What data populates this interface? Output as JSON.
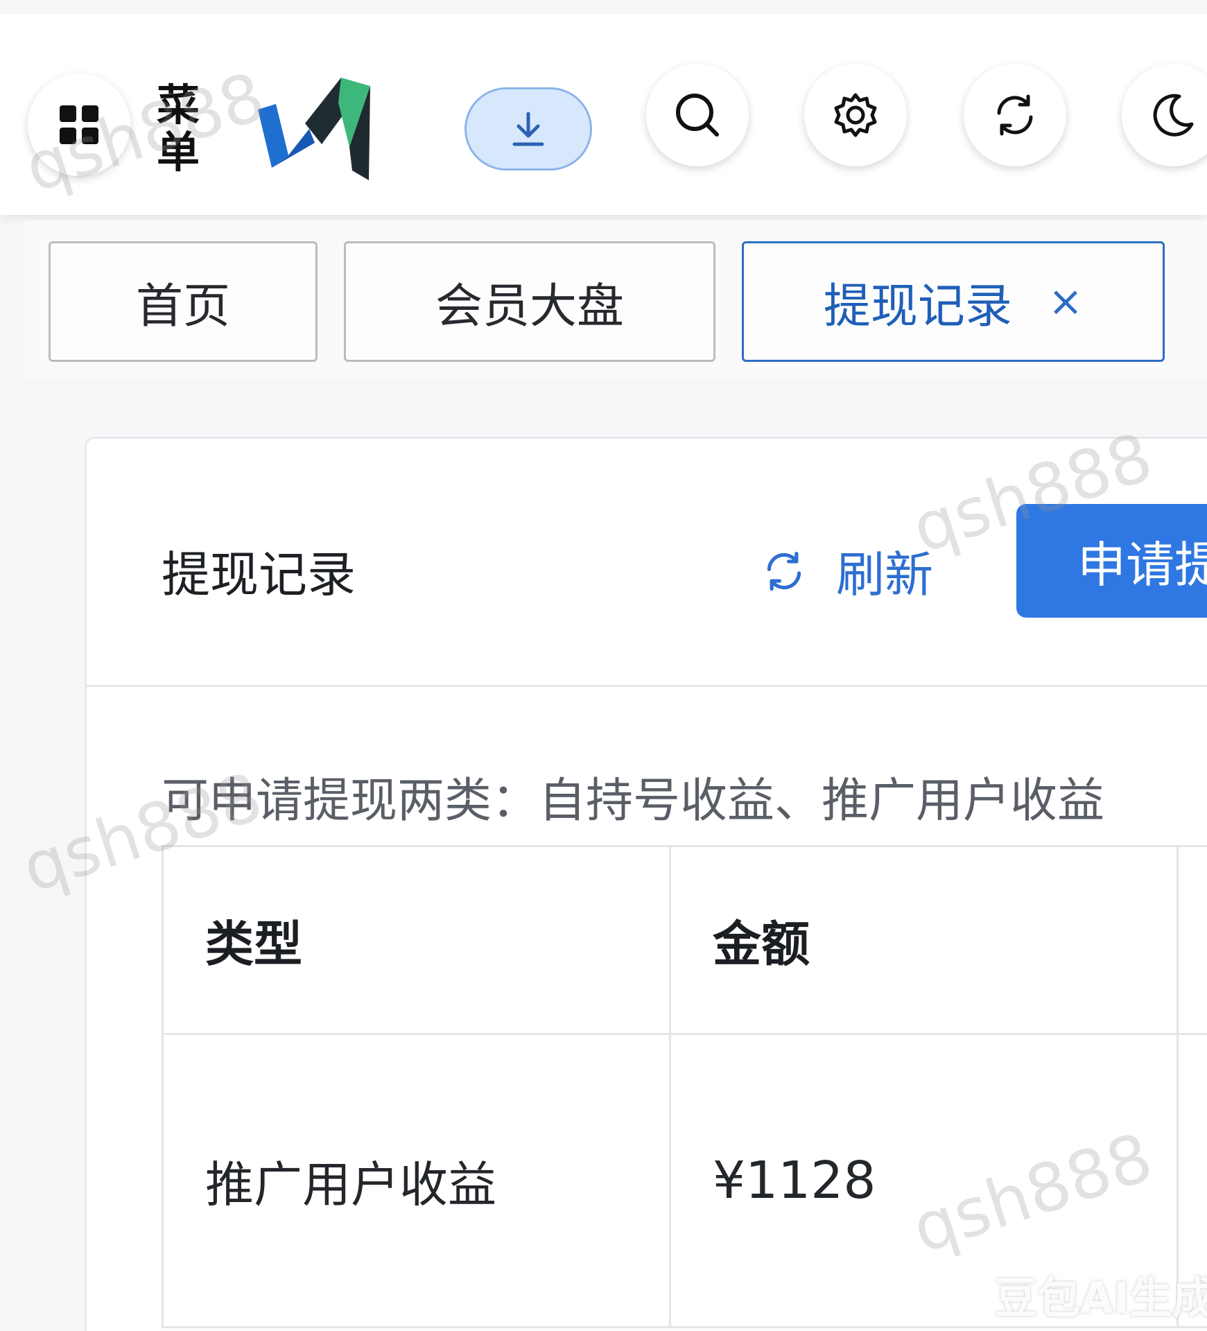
{
  "header": {
    "menu_label": "菜单",
    "icons": [
      "grid-icon",
      "download-icon",
      "search-icon",
      "gear-icon",
      "refresh-icon",
      "moon-icon"
    ]
  },
  "tabs": [
    {
      "label": "首页"
    },
    {
      "label": "会员大盘"
    },
    {
      "label": "提现记录",
      "close": "×"
    }
  ],
  "card": {
    "title": "提现记录",
    "refresh_label": "刷新",
    "apply_label": "申请提现",
    "notice": "可申请提现两类：自持号收益、推广用户收益"
  },
  "table": {
    "columns": [
      "类型",
      "金额"
    ],
    "rows": [
      {
        "type": "推广用户收益",
        "amount": "¥1128"
      }
    ]
  },
  "watermarks": [
    "qsh888",
    "qsh888",
    "qsh888",
    "qsh888"
  ],
  "ai_label": "豆包AI生成",
  "colors": {
    "primary": "#2f78e3",
    "active_tab": "#2f6dc4",
    "download_bg": "#d8e8fc"
  }
}
